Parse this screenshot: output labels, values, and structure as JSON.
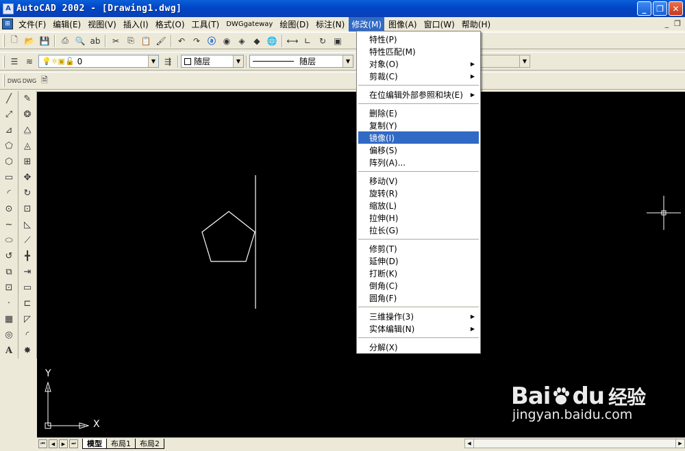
{
  "window": {
    "title": "AutoCAD 2002 - [Drawing1.dwg]",
    "buttons": [
      "_",
      "❐",
      "✕"
    ]
  },
  "menubar": {
    "items": [
      "文件(F)",
      "编辑(E)",
      "视图(V)",
      "插入(I)",
      "格式(O)",
      "工具(T)",
      "DWGgateway",
      "绘图(D)",
      "标注(N)",
      "修改(M)",
      "图像(A)",
      "窗口(W)",
      "帮助(H)"
    ],
    "active": "修改(M)",
    "mdi_buttons": [
      "_",
      "❐"
    ]
  },
  "toolbar_layers": {
    "layer_value": "0",
    "color_value": "随层",
    "linetype_value": "随层"
  },
  "modify_menu": {
    "items": [
      {
        "label": "特性(P)",
        "submenu": false,
        "selected": false
      },
      {
        "label": "特性匹配(M)",
        "submenu": false,
        "selected": false
      },
      {
        "label": "对象(O)",
        "submenu": true,
        "selected": false
      },
      {
        "label": "剪裁(C)",
        "submenu": true,
        "selected": false
      },
      {
        "sep": true
      },
      {
        "label": "在位编辑外部参照和块(E)",
        "submenu": true,
        "selected": false
      },
      {
        "sep": true
      },
      {
        "label": "删除(E)",
        "submenu": false,
        "selected": false
      },
      {
        "label": "复制(Y)",
        "submenu": false,
        "selected": false
      },
      {
        "label": "镜像(I)",
        "submenu": false,
        "selected": true
      },
      {
        "label": "偏移(S)",
        "submenu": false,
        "selected": false
      },
      {
        "label": "阵列(A)...",
        "submenu": false,
        "selected": false
      },
      {
        "sep": true
      },
      {
        "label": "移动(V)",
        "submenu": false,
        "selected": false
      },
      {
        "label": "旋转(R)",
        "submenu": false,
        "selected": false
      },
      {
        "label": "缩放(L)",
        "submenu": false,
        "selected": false
      },
      {
        "label": "拉伸(H)",
        "submenu": false,
        "selected": false
      },
      {
        "label": "拉长(G)",
        "submenu": false,
        "selected": false
      },
      {
        "sep": true
      },
      {
        "label": "修剪(T)",
        "submenu": false,
        "selected": false
      },
      {
        "label": "延伸(D)",
        "submenu": false,
        "selected": false
      },
      {
        "label": "打断(K)",
        "submenu": false,
        "selected": false
      },
      {
        "label": "倒角(C)",
        "submenu": false,
        "selected": false
      },
      {
        "label": "圆角(F)",
        "submenu": false,
        "selected": false
      },
      {
        "sep": true
      },
      {
        "label": "三维操作(3)",
        "submenu": true,
        "selected": false
      },
      {
        "label": "实体编辑(N)",
        "submenu": true,
        "selected": false
      },
      {
        "sep": true
      },
      {
        "label": "分解(X)",
        "submenu": false,
        "selected": false
      }
    ]
  },
  "canvas": {
    "ucs_x_label": "X",
    "ucs_y_label": "Y",
    "tabs": [
      "模型",
      "布局1",
      "布局2"
    ],
    "active_tab": "模型"
  },
  "watermark": {
    "logo_left": "Bai",
    "logo_right": "du",
    "logo_cn": "经验",
    "url": "jingyan.baidu.com"
  },
  "colors": {
    "titlebar": "#0046c8",
    "menu_highlight": "#316ac5",
    "canvas_bg": "#000000",
    "drawing_stroke": "#ffffff"
  }
}
